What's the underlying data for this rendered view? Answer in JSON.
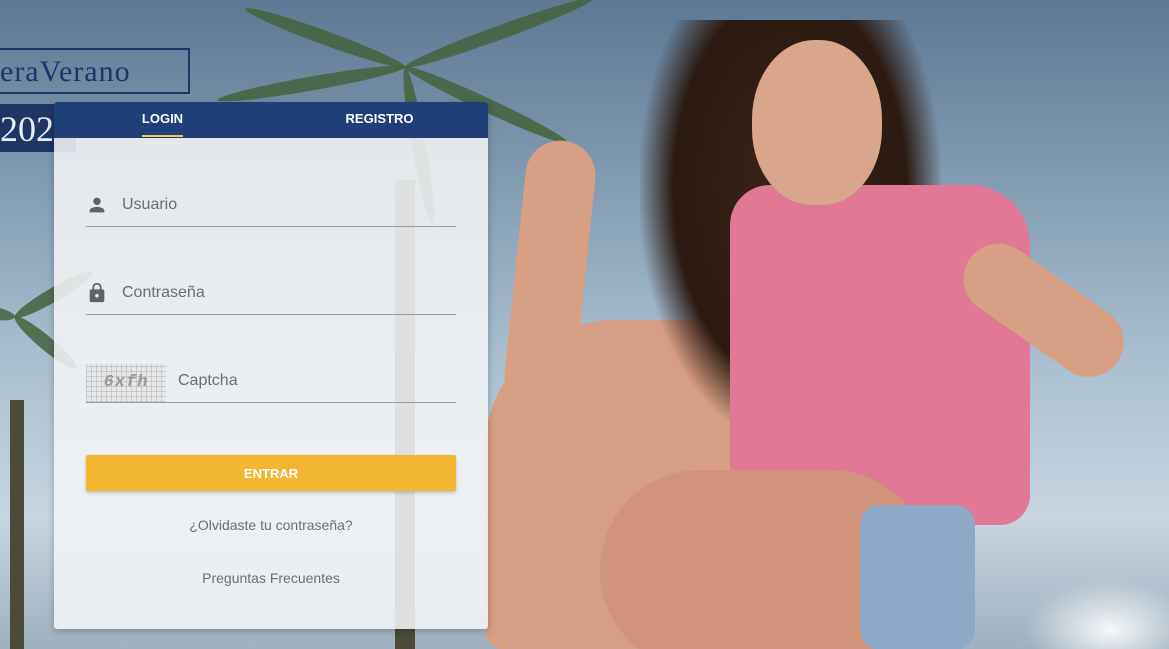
{
  "brand": {
    "name": "eraVerano",
    "year": "202"
  },
  "tabs": [
    {
      "label": "LOGIN",
      "active": true
    },
    {
      "label": "REGISTRO",
      "active": false
    }
  ],
  "form": {
    "username_placeholder": "Usuario",
    "password_placeholder": "Contraseña",
    "captcha_code": "6xfh",
    "captcha_placeholder": "Captcha",
    "submit_label": "ENTRAR"
  },
  "links": {
    "forgot_password": "¿Olvidaste tu contraseña?",
    "faq": "Preguntas Frecuentes"
  },
  "colors": {
    "header_blue": "#203e78",
    "accent_yellow": "#f2b632",
    "tab_underline": "#f2c94c"
  },
  "icons": {
    "username": "person-icon",
    "password": "lock-icon"
  }
}
